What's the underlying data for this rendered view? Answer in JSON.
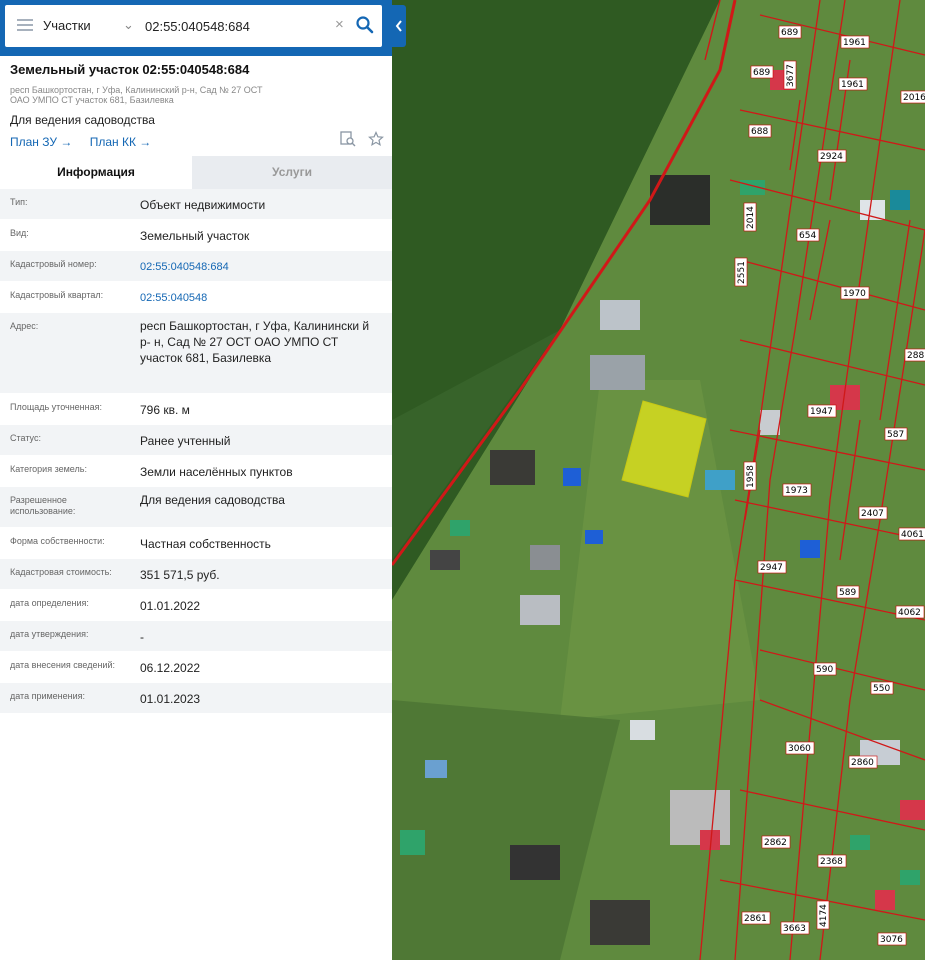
{
  "search": {
    "category": "Участки",
    "query": "02:55:040548:684",
    "clear_icon": "close-icon",
    "search_icon": "search-icon"
  },
  "plot": {
    "title": "Земельный участок 02:55:040548:684",
    "address_short": "респ Башкортостан, г Уфа, Калининский р-н, Сад № 27 ОСТ ОАО УМПО СТ участок 681, Базилевка",
    "purpose": "Для ведения садоводства",
    "links": [
      "План ЗУ →",
      "План КК →"
    ]
  },
  "tabs": {
    "info": "Информация",
    "services": "Услуги"
  },
  "rows": [
    {
      "label": "Тип:",
      "value": "Объект недвижимости"
    },
    {
      "label": "Вид:",
      "value": "Земельный участок"
    },
    {
      "label": "Кадастровый номер:",
      "value": "02:55:040548:684",
      "link": true
    },
    {
      "label": "Кадастровый квартал:",
      "value": "02:55:040548",
      "link": true
    },
    {
      "label": "Адрес:",
      "value": "респ Башкортостан, г Уфа, Калинински й р- н, Сад № 27 ОСТ ОАО УМПО СТ участок 681, Базилевка"
    },
    {
      "label": "Площадь уточненная:",
      "value": "796 кв. м"
    },
    {
      "label": "Статус:",
      "value": "Ранее учтенный"
    },
    {
      "label": "Категория земель:",
      "value": "Земли населённых пунктов"
    },
    {
      "label": "Разрешенное использование:",
      "value": "Для ведения садоводства"
    },
    {
      "label": "Форма собственности:",
      "value": "Частная собственность"
    },
    {
      "label": "Кадастровая стоимость:",
      "value": "351 571,5 руб."
    },
    {
      "label": "дата определения:",
      "value": "01.01.2022"
    },
    {
      "label": "дата утверждения:",
      "value": "-"
    },
    {
      "label": "дата внесения сведений:",
      "value": "06.12.2022"
    },
    {
      "label": "дата применения:",
      "value": "01.01.2023"
    }
  ],
  "map": {
    "parcel_labels": [
      "689",
      "1961",
      "3677",
      "689",
      "1961",
      "2016",
      "688",
      "2924",
      "2014",
      "654",
      "2551",
      "1970",
      "288",
      "1947",
      "587",
      "1958",
      "1973",
      "2407",
      "4061",
      "2947",
      "589",
      "4062",
      "590",
      "550",
      "3060",
      "2860",
      "2862",
      "2368",
      "2861",
      "3663",
      "4174",
      "3076"
    ]
  },
  "colors": {
    "accent": "#1467b4",
    "selected_parcel": "#e6e61a",
    "boundary": "#d01818"
  }
}
